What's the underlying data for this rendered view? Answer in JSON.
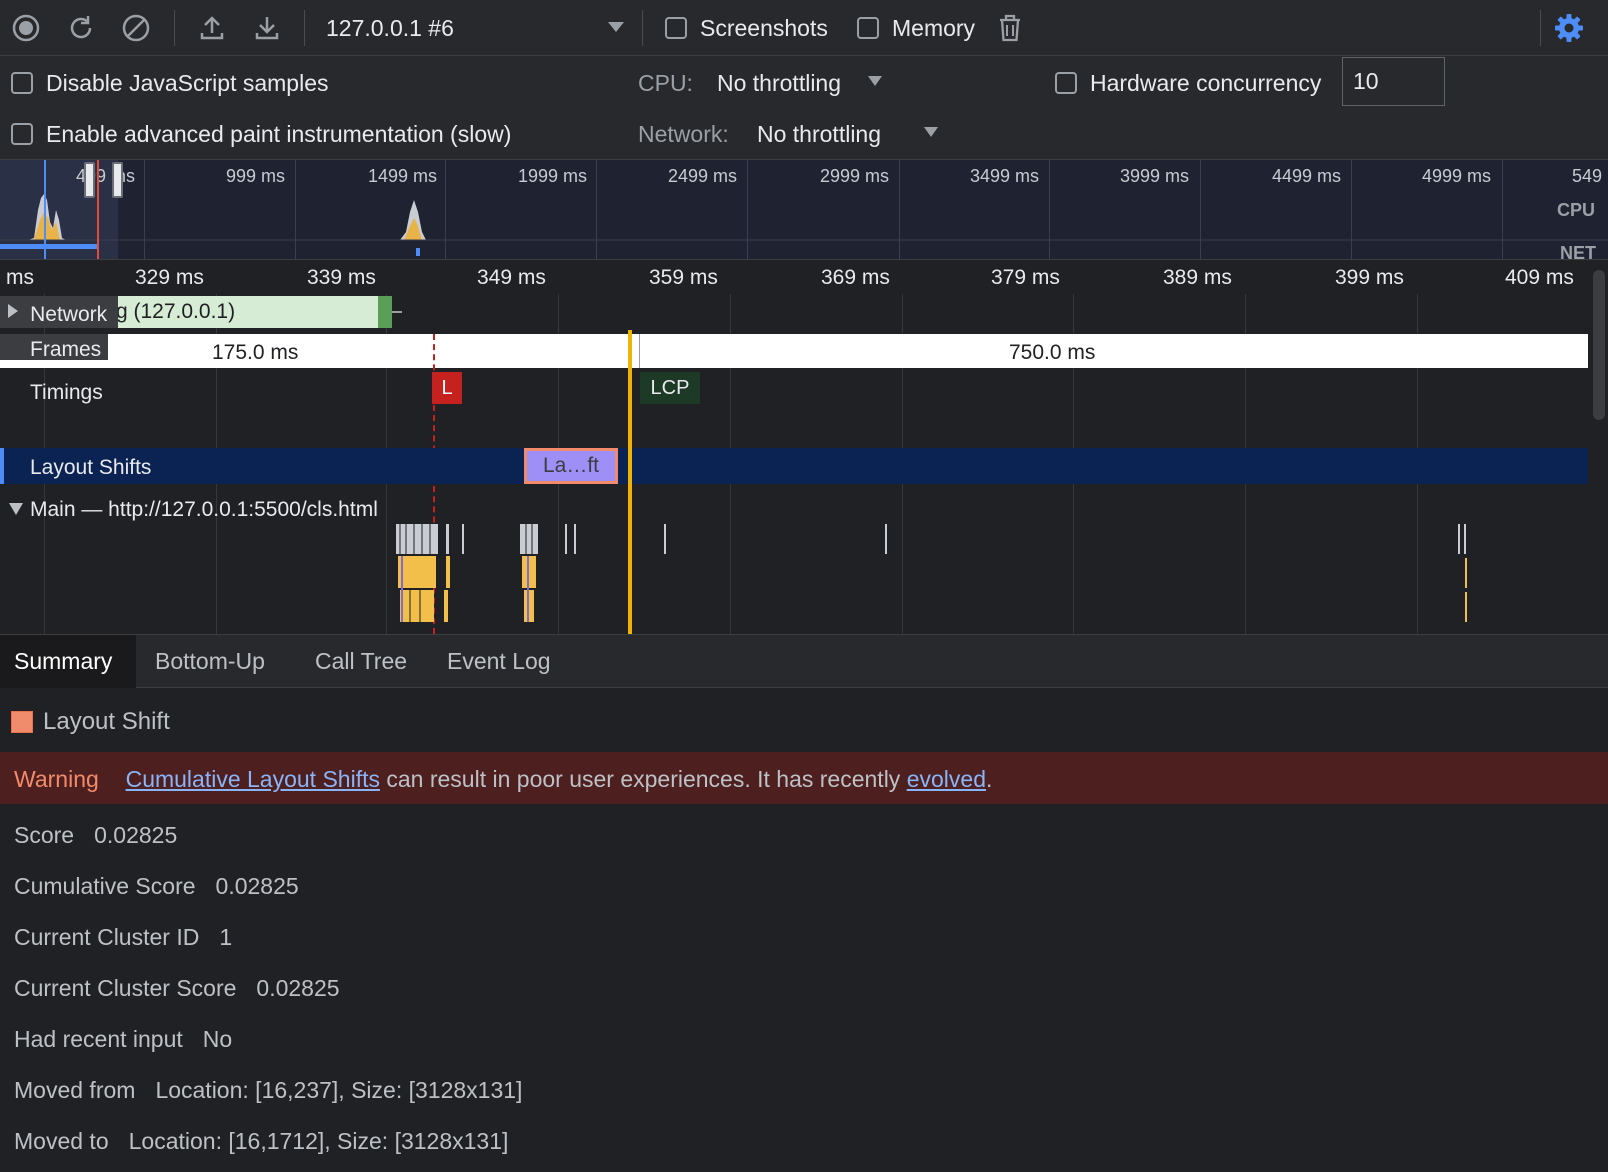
{
  "toolbar": {
    "profile_select": "127.0.0.1 #6",
    "screenshots_label": "Screenshots",
    "memory_label": "Memory"
  },
  "settings": {
    "disable_js_samples": "Disable JavaScript samples",
    "advanced_paint": "Enable advanced paint instrumentation (slow)",
    "cpu_label": "CPU:",
    "cpu_value": "No throttling",
    "network_label": "Network:",
    "network_value": "No throttling",
    "hw_concurrency_label": "Hardware concurrency",
    "hw_concurrency_value": "10"
  },
  "overview": {
    "ticks": [
      "499 ms",
      "999 ms",
      "1499 ms",
      "1999 ms",
      "2499 ms",
      "2999 ms",
      "3499 ms",
      "3999 ms",
      "4499 ms",
      "4999 ms",
      "549"
    ],
    "cpu_label": "CPU",
    "net_label": "NET"
  },
  "ruler": {
    "ticks": [
      "ms",
      "329 ms",
      "339 ms",
      "349 ms",
      "359 ms",
      "369 ms",
      "379 ms",
      "389 ms",
      "399 ms",
      "409 ms"
    ]
  },
  "tracks": {
    "network_label": "Network",
    "network_request": "g (127.0.0.1)",
    "frames_label": "Frames",
    "frame_1": "175.0 ms",
    "frame_2": "750.0 ms",
    "timings_label": "Timings",
    "marker_l": "L",
    "marker_lcp": "LCP",
    "layout_shifts_label": "Layout Shifts",
    "layout_shift_block": "La…ft",
    "main_label": "Main — http://127.0.0.1:5500/cls.html"
  },
  "tabs": [
    "Summary",
    "Bottom-Up",
    "Call Tree",
    "Event Log"
  ],
  "summary": {
    "title": "Layout Shift",
    "color": "#f28b6b",
    "warning_label": "Warning",
    "warning_link_1": "Cumulative Layout Shifts",
    "warning_text": " can result in poor user experiences. It has recently ",
    "warning_link_2": "evolved",
    "warning_end": ".",
    "rows": [
      {
        "key": "Score",
        "value": "0.02825"
      },
      {
        "key": "Cumulative Score",
        "value": "0.02825"
      },
      {
        "key": "Current Cluster ID",
        "value": "1"
      },
      {
        "key": "Current Cluster Score",
        "value": "0.02825"
      },
      {
        "key": "Had recent input",
        "value": "No"
      },
      {
        "key": "Moved from",
        "value": "Location: [16,237], Size: [3128x131]"
      },
      {
        "key": "Moved to",
        "value": "Location: [16,1712], Size: [3128x131]"
      }
    ]
  }
}
